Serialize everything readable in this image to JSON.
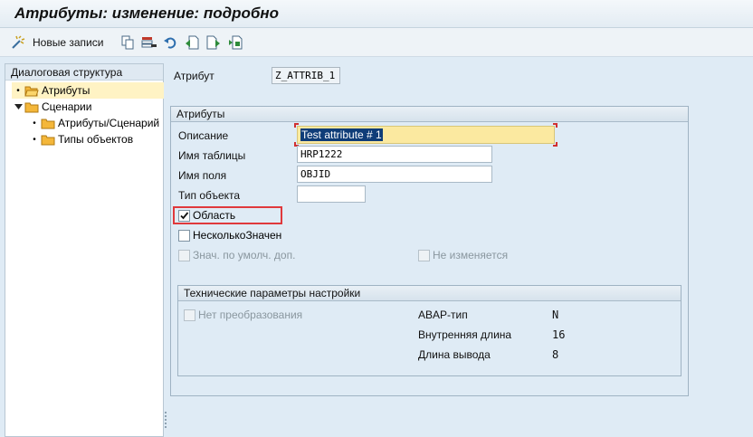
{
  "window": {
    "title": "Атрибуты: изменение: подробно"
  },
  "toolbar": {
    "new_entries_label": "Новые записи",
    "icons": [
      "new-entries-icon",
      "copy-icon",
      "delete-icon",
      "undo-icon",
      "previous-entry-icon",
      "next-entry-icon",
      "select-icon"
    ]
  },
  "tree": {
    "header": "Диалоговая структура",
    "items": [
      {
        "label": "Атрибуты",
        "selected": true,
        "level": 0
      },
      {
        "label": "Сценарии",
        "expanded": true,
        "level": 0
      },
      {
        "label": "Атрибуты/Сценарий",
        "level": 1
      },
      {
        "label": "Типы объектов",
        "level": 1
      }
    ]
  },
  "attribute": {
    "label": "Атрибут",
    "value": "Z_ATTRIB_1"
  },
  "attributes_group": {
    "title": "Атрибуты",
    "description": {
      "label": "Описание",
      "value": "Test attribute # 1"
    },
    "table_name": {
      "label": "Имя таблицы",
      "value": "HRP1222"
    },
    "field_name": {
      "label": "Имя поля",
      "value": "OBJID"
    },
    "object_type": {
      "label": "Тип объекта",
      "value": ""
    },
    "area": {
      "label": "Область",
      "checked": true
    },
    "multiple_values": {
      "label": "НесколькоЗначен",
      "checked": false
    },
    "default_value_add": {
      "label": "Знач. по умолч. доп.",
      "checked": false,
      "disabled": true
    },
    "unchangeable": {
      "label": "Не изменяется",
      "checked": false,
      "disabled": true
    }
  },
  "tech_group": {
    "title": "Технические параметры настройки",
    "no_conversion": {
      "label": "Нет преобразования",
      "checked": false,
      "disabled": true
    },
    "abap_type": {
      "label": "ABAP-тип",
      "value": "N"
    },
    "internal_length": {
      "label": "Внутренняя длина",
      "value": "16"
    },
    "output_length": {
      "label": "Длина вывода",
      "value": "8"
    }
  },
  "colors": {
    "background": "#dfebf5",
    "selection": "#0f3d78",
    "focus_field": "#fbe9a0",
    "highlight_border": "#e0393c"
  }
}
